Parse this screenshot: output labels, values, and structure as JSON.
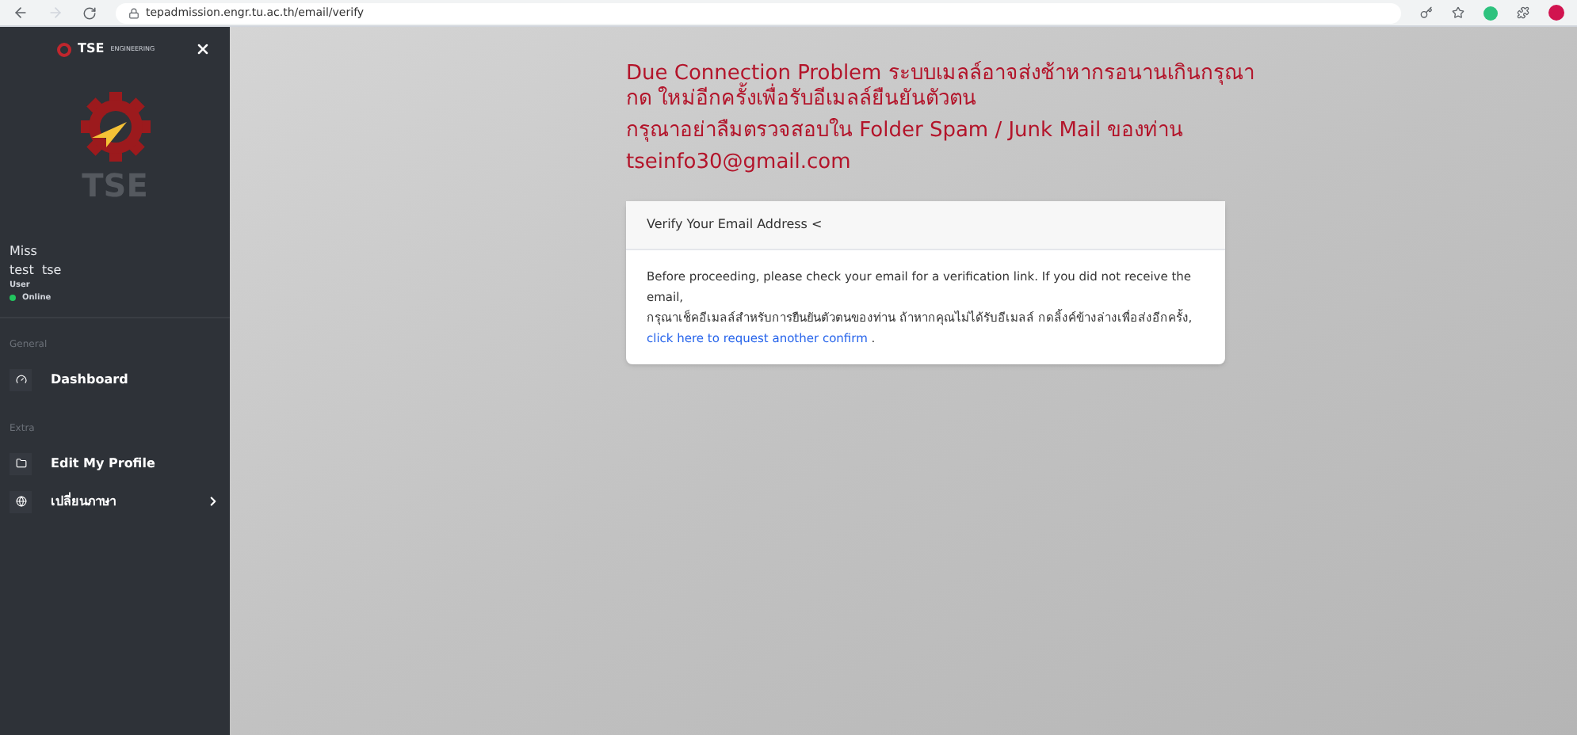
{
  "browser": {
    "url": "tepadmission.engr.tu.ac.th/email/verify"
  },
  "sidebar": {
    "logo_text": "TSE",
    "logo_subtext": "ENGINEERING",
    "emblem_text": "TSE",
    "user": {
      "title": "Miss",
      "name": "test  tse",
      "role": "User",
      "status": "Online",
      "online": true
    },
    "sections": [
      {
        "heading": "General",
        "items": [
          {
            "label": "Dashboard",
            "kind": "dashboard",
            "submenu": false
          }
        ]
      },
      {
        "heading": "Extra",
        "items": [
          {
            "label": "Edit My Profile",
            "kind": "folder",
            "submenu": false
          },
          {
            "label": "เปลี่ยนภาษา",
            "kind": "globe",
            "submenu": true
          }
        ]
      }
    ]
  },
  "notice": {
    "lines": [
      "Due Connection Problem ระบบเมลล์อาจส่งช้าหากรอนานเกินกรุณากด ใหม่อีกครั้งเพื่อรับอีเมลล์ยืนยันตัวตน",
      "กรุณาอย่าลืมตรวจสอบใน Folder Spam / Junk Mail ของท่าน",
      "tseinfo30@gmail.com"
    ]
  },
  "card": {
    "title": "Verify Your Email Address <",
    "text_en": "Before proceeding, please check your email for a verification link. If you did not receive the email,",
    "text_th": "กรุณาเช็คอีเมลล์สำหรับการยืนยันตัวตนของท่าน ถ้าหากคุณไม่ได้รับอีเมลล์ กดลิ้งค์ข้างล่างเพื่อส่งอีกครั้ง,",
    "link": "click here to request another confirm",
    "after_link": "."
  }
}
